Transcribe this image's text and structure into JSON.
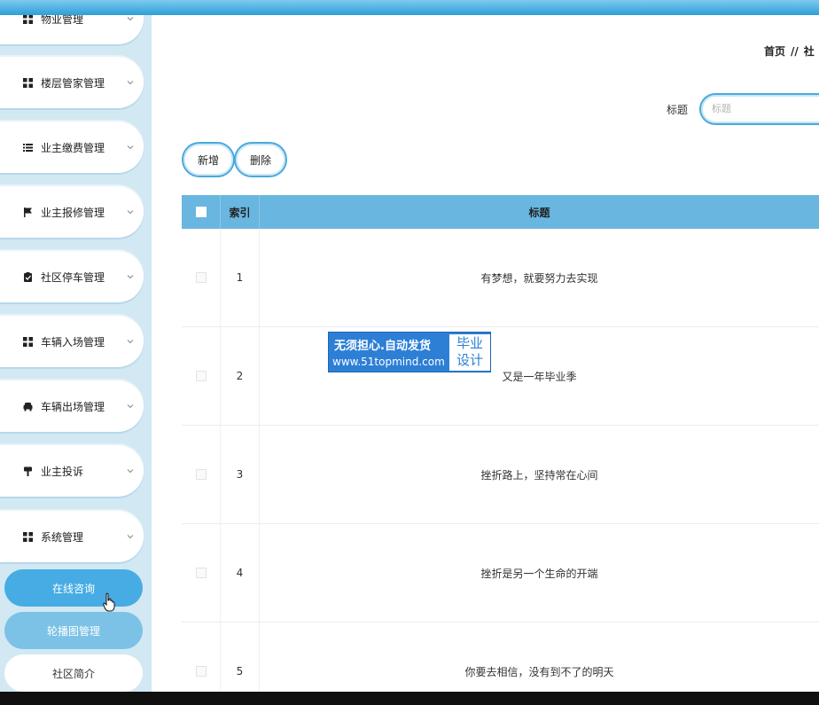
{
  "sidebar": {
    "items": [
      {
        "label": "物业管理",
        "icon": "grid-icon"
      },
      {
        "label": "楼层管家管理",
        "icon": "grid-icon"
      },
      {
        "label": "业主缴费管理",
        "icon": "list-icon"
      },
      {
        "label": "业主报修管理",
        "icon": "flag-icon"
      },
      {
        "label": "社区停车管理",
        "icon": "clipboard-check-icon"
      },
      {
        "label": "车辆入场管理",
        "icon": "grid-icon"
      },
      {
        "label": "车辆出场管理",
        "icon": "car-icon"
      },
      {
        "label": "业主投诉",
        "icon": "gavel-icon"
      },
      {
        "label": "系统管理",
        "icon": "grid-icon"
      }
    ],
    "sub_items": [
      {
        "label": "在线咨询",
        "state": "active"
      },
      {
        "label": "轮播图管理",
        "state": "hover"
      },
      {
        "label": "社区简介",
        "state": "normal"
      }
    ]
  },
  "breadcrumb": {
    "home": "首页",
    "separator": "//",
    "current": "社"
  },
  "search": {
    "label": "标题",
    "placeholder": "标题",
    "value": ""
  },
  "toolbar": {
    "add_label": "新增",
    "delete_label": "删除"
  },
  "table": {
    "headers": {
      "index": "索引",
      "title": "标题"
    },
    "rows": [
      {
        "index": "1",
        "title": "有梦想，就要努力去实现"
      },
      {
        "index": "2",
        "title": "又是一年毕业季"
      },
      {
        "index": "3",
        "title": "挫折路上，坚持常在心间"
      },
      {
        "index": "4",
        "title": "挫折是另一个生命的开端"
      },
      {
        "index": "5",
        "title": "你要去相信，没有到不了的明天"
      }
    ]
  },
  "watermark": {
    "line1": "无须担心.自动发货",
    "line2": "www.51topmind.com",
    "right_line1": "毕业",
    "right_line2": "设计"
  },
  "colors": {
    "accent": "#47ace3",
    "header": "#69b6e0",
    "sidebar_bg": "#d2e8f3"
  }
}
